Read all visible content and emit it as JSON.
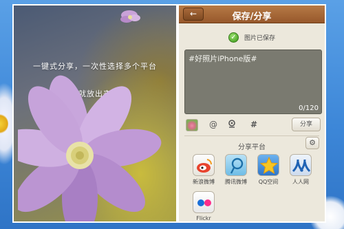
{
  "photo": {
    "line1": "一键式分享，一次性选择多个平台",
    "line2": "有料就放出来吧！"
  },
  "header": {
    "title": "保存/分享",
    "back_icon": "back-arrow-icon"
  },
  "status": {
    "saved_label": "图片已保存",
    "saved_icon": "check-circle-icon"
  },
  "compose": {
    "text": "#好照片iPhone版#",
    "counter": "0/120"
  },
  "toolbar": {
    "at_symbol": "@",
    "location_icon": "location-icon",
    "hash_symbol": "#",
    "share_label": "分享"
  },
  "platforms": {
    "title": "分享平台",
    "items": [
      {
        "label": "新浪微博",
        "icon": "sina-weibo-icon"
      },
      {
        "label": "腾讯微博",
        "icon": "tencent-weibo-icon"
      },
      {
        "label": "QQ空间",
        "icon": "qzone-icon"
      },
      {
        "label": "人人网",
        "icon": "renren-icon"
      },
      {
        "label": "Flickr",
        "icon": "flickr-icon"
      }
    ]
  },
  "colors": {
    "desktop": "#3d87d8",
    "header": "#a66a38",
    "panel": "#ece8dc",
    "textarea": "#7a7a70"
  }
}
